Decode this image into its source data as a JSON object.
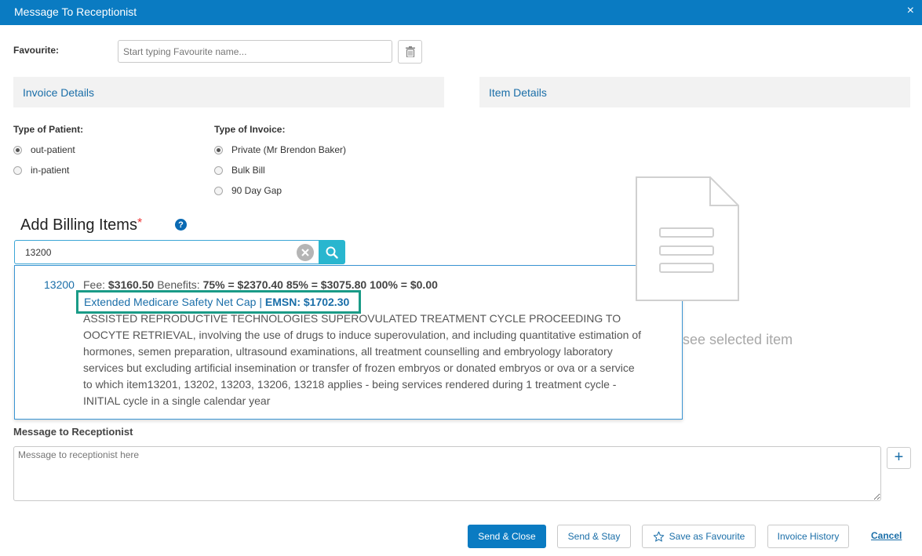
{
  "window": {
    "title": "Message To Receptionist",
    "close_glyph": "×"
  },
  "favourite": {
    "label": "Favourite:",
    "placeholder": "Start typing Favourite name..."
  },
  "panels": {
    "left_title": "Invoice Details",
    "right_title": "Item Details"
  },
  "patient_type": {
    "label": "Type of Patient:",
    "options": [
      {
        "label": "out-patient",
        "selected": true
      },
      {
        "label": "in-patient",
        "selected": false
      }
    ]
  },
  "invoice_type": {
    "label": "Type of Invoice:",
    "options": [
      {
        "label": "Private (Mr Brendon Baker)",
        "selected": true
      },
      {
        "label": "Bulk Bill",
        "selected": false
      },
      {
        "label": "90 Day Gap",
        "selected": false
      }
    ]
  },
  "billing": {
    "title": "Add Billing Items",
    "required_mark": "*",
    "help_glyph": "?",
    "search_value": "13200"
  },
  "result": {
    "code": "13200",
    "fee_label": "Fee:",
    "fee_value": "$3160.50",
    "benefits_label": "Benefits:",
    "benefits_value": "75% = $2370.40 85% = $3075.80 100% = $0.00",
    "emsn_text": "Extended Medicare Safety Net Cap |",
    "emsn_value": "EMSN: $1702.30",
    "description": "ASSISTED REPRODUCTIVE TECHNOLOGIES SUPEROVULATED TREATMENT CYCLE PROCEEDING TO OOCYTE RETRIEVAL, involving the use of drugs to induce superovulation, and including quantitative estimation of hormones, semen preparation, ultrasound examinations, all treatment counselling and embryology laboratory services but excluding artificial insemination or transfer of frozen embryos or donated embryos or ova or a service to which item13201, 13202, 13203, 13206, 13218 applies - being services rendered during 1 treatment cycle - INITIAL cycle in a single calendar year"
  },
  "item_details": {
    "empty_hint": "see selected item"
  },
  "message": {
    "label": "Message to Receptionist",
    "placeholder": "Message to receptionist here",
    "add_glyph": "+"
  },
  "actions": {
    "send_close": "Send & Close",
    "send_stay": "Send & Stay",
    "save_favourite": "Save as Favourite",
    "invoice_history": "Invoice History",
    "cancel": "Cancel"
  },
  "colors": {
    "brand": "#0a7bc2",
    "highlight": "#1a9b87",
    "search_button": "#29b6cf"
  }
}
